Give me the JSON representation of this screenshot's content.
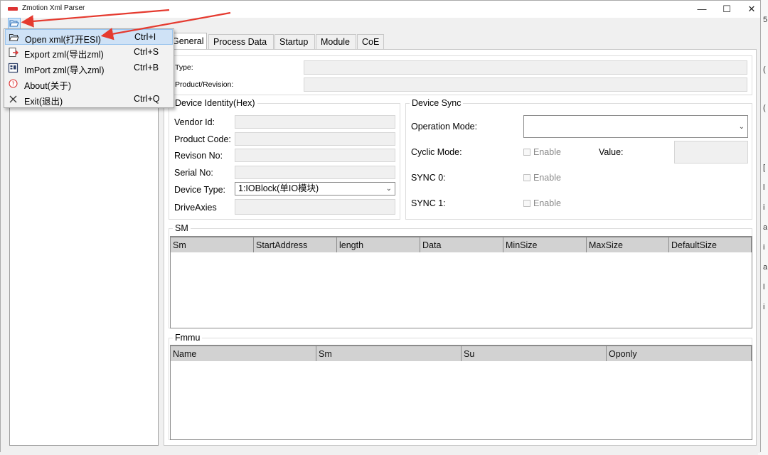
{
  "window": {
    "title": "Zmotion Xml Parser",
    "controls": {
      "minimize": "—",
      "maximize": "☐",
      "close": "✕"
    }
  },
  "file_menu": {
    "items": [
      {
        "label": "Open xml(打开ESI)",
        "shortcut": "Ctrl+I",
        "icon": "open-folder-icon"
      },
      {
        "label": "Export zml(导出zml)",
        "shortcut": "Ctrl+S",
        "icon": "export-icon"
      },
      {
        "label": "ImPort zml(导入zml)",
        "shortcut": "Ctrl+B",
        "icon": "import-icon"
      },
      {
        "label": "About(关于)",
        "shortcut": "",
        "icon": "help-circle-icon"
      },
      {
        "label": "Exit(退出)",
        "shortcut": "Ctrl+Q",
        "icon": "close-x-icon"
      }
    ]
  },
  "tabs": [
    "General",
    "Process Data",
    "Startup",
    "Module",
    "CoE"
  ],
  "general": {
    "type_label": "Type:",
    "product_revision_label": "Product/Revision:"
  },
  "device_identity": {
    "title": "Device Identity(Hex)",
    "vendor_id": "Vendor Id:",
    "product_code": "Product Code:",
    "revision_no": "Revison No:",
    "serial_no": "Serial No:",
    "device_type": "Device Type:",
    "device_type_value": "1:IOBlock(单IO模块)",
    "drive_axies": "DriveAxies"
  },
  "device_sync": {
    "title": "Device Sync",
    "operation_mode": "Operation Mode:",
    "operation_mode_value": "",
    "cyclic_mode": "Cyclic Mode:",
    "value_label": "Value:",
    "sync0": "SYNC 0:",
    "sync1": "SYNC 1:",
    "enable": "Enable"
  },
  "sm": {
    "title": "SM",
    "columns": [
      "Sm",
      "StartAddress",
      "length",
      "Data",
      "MinSize",
      "MaxSize",
      "DefaultSize"
    ]
  },
  "fmmu": {
    "title": "Fmmu",
    "columns": [
      "Name",
      "Sm",
      "Su",
      "Oponly"
    ]
  },
  "background_edge_glyphs": [
    "5",
    "(",
    "(",
    "[",
    "l",
    "i",
    "a",
    "i",
    "a",
    "l",
    "i"
  ],
  "colors": {
    "menu_highlight": "#cfe2f6",
    "annotation_arrow": "#e53a2f",
    "grid_header": "#d2d2d2"
  }
}
